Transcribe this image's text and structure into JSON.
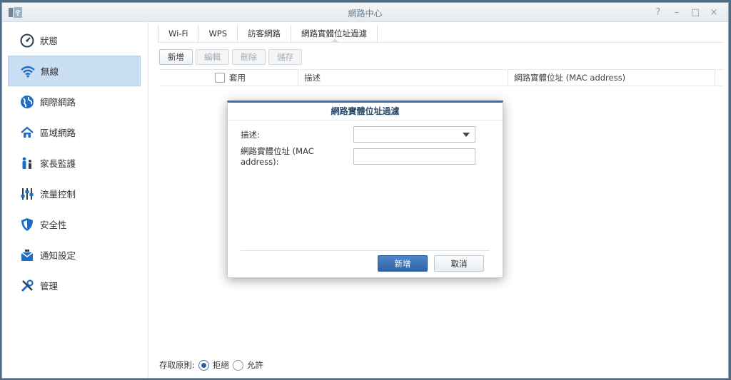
{
  "window": {
    "title": "網路中心",
    "controls": [
      "?",
      "–",
      "□",
      "×"
    ]
  },
  "sidebar": {
    "items": [
      {
        "label": "狀態",
        "icon": "gauge-icon",
        "active": false
      },
      {
        "label": "無線",
        "icon": "wifi-icon",
        "active": true
      },
      {
        "label": "網際網路",
        "icon": "globe-icon",
        "active": false
      },
      {
        "label": "區域網路",
        "icon": "home-network-icon",
        "active": false
      },
      {
        "label": "家長監護",
        "icon": "family-icon",
        "active": false
      },
      {
        "label": "流量控制",
        "icon": "sliders-icon",
        "active": false
      },
      {
        "label": "安全性",
        "icon": "shield-icon",
        "active": false
      },
      {
        "label": "通知設定",
        "icon": "notification-icon",
        "active": false
      },
      {
        "label": "管理",
        "icon": "tools-icon",
        "active": false
      }
    ]
  },
  "tabs": [
    {
      "label": "Wi-Fi"
    },
    {
      "label": "WPS"
    },
    {
      "label": "訪客網路"
    },
    {
      "label": "網路實體位址過濾"
    }
  ],
  "toolbar": {
    "add": "新增",
    "edit": "編輯",
    "delete": "刪除",
    "save": "儲存"
  },
  "grid": {
    "columns": [
      "套用",
      "描述",
      "網路實體位址 (MAC address)"
    ]
  },
  "footer": {
    "policy_label": "存取原則:",
    "deny": "拒絕",
    "allow": "允許",
    "selected": "deny"
  },
  "dialog": {
    "title": "網路實體位址過濾",
    "description_label": "描述:",
    "description_value": "",
    "mac_label": "網路實體位址 (MAC address):",
    "mac_value": "",
    "ok": "新增",
    "cancel": "取消"
  },
  "colors": {
    "accent": "#2f63a8",
    "active_nav": "#c9def2",
    "icon_blue": "#1f6cc7"
  }
}
